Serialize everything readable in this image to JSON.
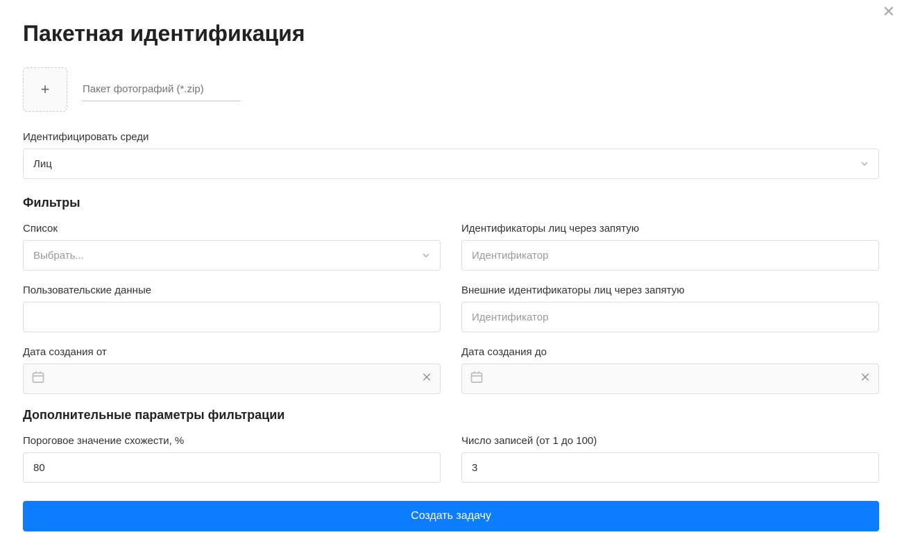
{
  "title": "Пакетная идентификация",
  "upload": {
    "placeholder": "Пакет фотографий (*.zip)"
  },
  "identify_among": {
    "label": "Идентифицировать среди",
    "value": "Лиц"
  },
  "filters_heading": "Фильтры",
  "filters": {
    "list": {
      "label": "Список",
      "placeholder": "Выбрать..."
    },
    "face_ids": {
      "label": "Идентификаторы лиц через запятую",
      "placeholder": "Идентификатор"
    },
    "user_data": {
      "label": "Пользовательские данные",
      "value": ""
    },
    "ext_ids": {
      "label": "Внешние идентификаторы лиц через запятую",
      "placeholder": "Идентификатор"
    },
    "date_from": {
      "label": "Дата создания от",
      "value": ""
    },
    "date_to": {
      "label": "Дата создания до",
      "value": ""
    }
  },
  "extra_heading": "Дополнительные параметры фильтрации",
  "extra": {
    "threshold": {
      "label": "Пороговое значение схожести, %",
      "value": "80"
    },
    "limit": {
      "label": "Число записей (от 1 до 100)",
      "value": "3"
    }
  },
  "submit_label": "Создать задачу"
}
